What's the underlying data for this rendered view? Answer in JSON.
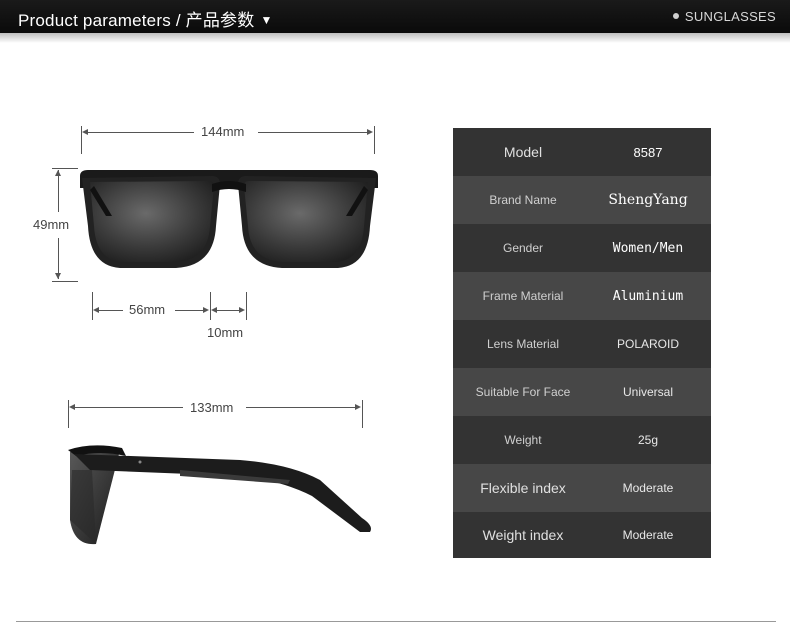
{
  "header": {
    "title": "Product parameters / 产品参数",
    "right_label": "SUNGLASSES"
  },
  "dimensions": {
    "total_width": "144mm",
    "lens_height": "49mm",
    "lens_width": "56mm",
    "bridge": "10mm",
    "temple_length": "133mm"
  },
  "specs": [
    {
      "label": "Model",
      "value": "8587"
    },
    {
      "label": "Brand Name",
      "value": "ShengYang"
    },
    {
      "label": "Gender",
      "value": "Women/Men"
    },
    {
      "label": "Frame Material",
      "value": "Aluminium"
    },
    {
      "label": "Lens Material",
      "value": "POLAROID"
    },
    {
      "label": "Suitable For Face",
      "value": "Universal"
    },
    {
      "label": "Weight",
      "value": "25g"
    },
    {
      "label": "Flexible index",
      "value": "Moderate"
    },
    {
      "label": "Weight index",
      "value": "Moderate"
    }
  ],
  "colors": {
    "header_bg": "#111111",
    "table_dark": "#333333",
    "table_light": "#474747"
  }
}
